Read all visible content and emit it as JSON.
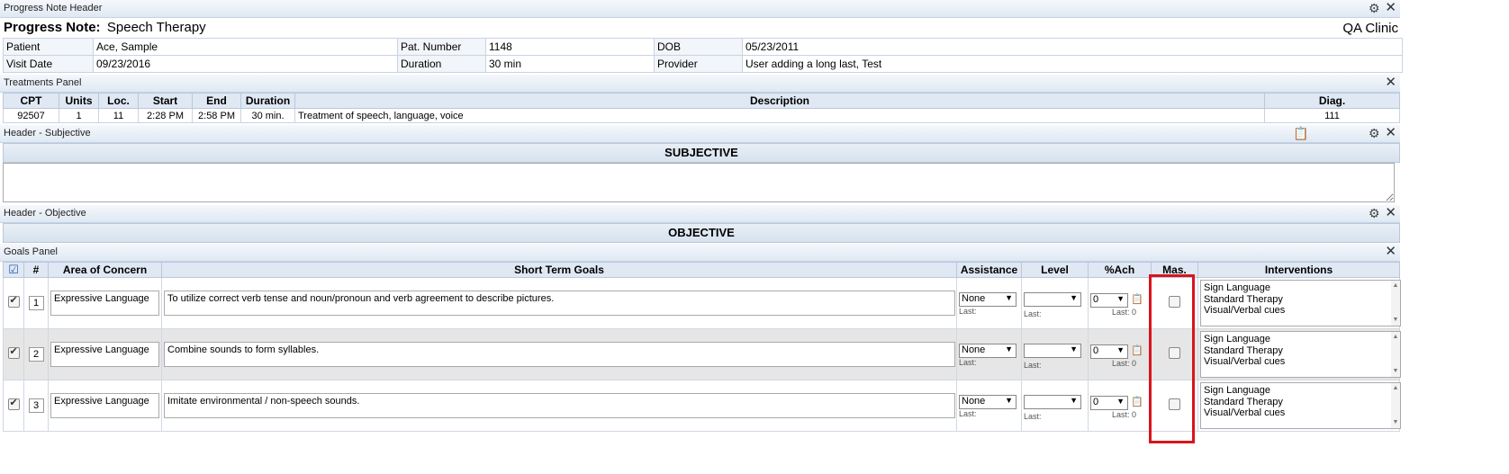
{
  "header_panel": {
    "title": "Progress Note Header"
  },
  "note": {
    "label": "Progress Note:",
    "type": "Speech Therapy",
    "clinic": "QA Clinic"
  },
  "info": {
    "patient_label": "Patient",
    "patient": "Ace, Sample",
    "patnum_label": "Pat. Number",
    "patnum": "1148",
    "dob_label": "DOB",
    "dob": "05/23/2011",
    "visit_label": "Visit Date",
    "visit": "09/23/2016",
    "duration_label": "Duration",
    "duration": "30 min",
    "provider_label": "Provider",
    "provider": "User adding a long last, Test"
  },
  "treatments": {
    "title": "Treatments Panel",
    "columns": [
      "CPT",
      "Units",
      "Loc.",
      "Start",
      "End",
      "Duration",
      "Description",
      "Diag."
    ],
    "rows": [
      {
        "cpt": "92507",
        "units": "1",
        "loc": "11",
        "start": "2:28 PM",
        "end": "2:58 PM",
        "duration": "30 min.",
        "description": "Treatment of speech, language, voice",
        "diag": "111"
      }
    ]
  },
  "subjective": {
    "panel_title": "Header - Subjective",
    "section": "SUBJECTIVE",
    "text": ""
  },
  "objective": {
    "panel_title": "Header - Objective",
    "section": "OBJECTIVE"
  },
  "goals": {
    "title": "Goals Panel",
    "columns": {
      "num": "#",
      "area": "Area of Concern",
      "stg": "Short Term Goals",
      "assist": "Assistance",
      "level": "Level",
      "ach": "%Ach",
      "mas": "Mas.",
      "interv": "Interventions"
    },
    "last_label": "Last:",
    "rows": [
      {
        "num": "1",
        "area": "Expressive Language",
        "goal": "To utilize correct verb tense and noun/pronoun and verb agreement to describe pictures.",
        "assist": "None",
        "level": "",
        "ach": "0",
        "last_ach": "Last: 0",
        "interventions": [
          "Sign Language",
          "Standard Therapy",
          "Visual/Verbal cues"
        ]
      },
      {
        "num": "2",
        "area": "Expressive Language",
        "goal": "Combine sounds to form syllables.",
        "assist": "None",
        "level": "",
        "ach": "0",
        "last_ach": "Last: 0",
        "interventions": [
          "Sign Language",
          "Standard Therapy",
          "Visual/Verbal cues"
        ]
      },
      {
        "num": "3",
        "area": "Expressive Language",
        "goal": "Imitate environmental / non-speech sounds.",
        "assist": "None",
        "level": "",
        "ach": "0",
        "last_ach": "Last: 0",
        "interventions": [
          "Sign Language",
          "Standard Therapy",
          "Visual/Verbal cues"
        ]
      }
    ]
  },
  "icons": {
    "gear": "gear-icon",
    "close": "close-icon",
    "notes": "clipboard-icon",
    "check_all": "check-all-icon"
  },
  "colors": {
    "highlight": "#d9141c",
    "panel_header": "#dfe8f3"
  }
}
